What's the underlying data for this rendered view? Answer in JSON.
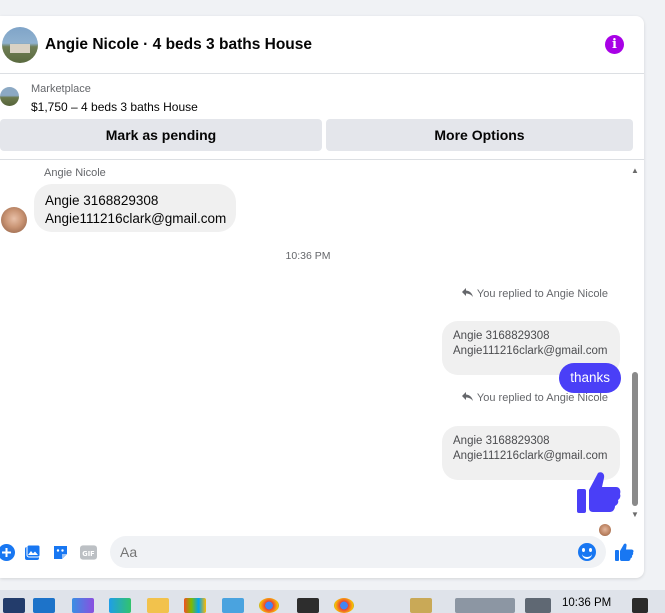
{
  "header": {
    "title": "Angie Nicole · 4 beds 3 baths House"
  },
  "listing": {
    "label": "Marketplace",
    "price": "$1,750 – 4 beds 3 baths House"
  },
  "actions": {
    "pending_label": "Mark as pending",
    "options_label": "More Options"
  },
  "conversation": {
    "sender_name": "Angie Nicole",
    "incoming": {
      "line1": "Angie 3168829308",
      "line2": "Angie111216clark@gmail.com"
    },
    "timestamp": "10:36 PM",
    "replies": [
      {
        "label": "You replied to Angie Nicole",
        "quote1": "Angie 3168829308",
        "quote2": "Angie111216clark@gmail.com",
        "message": "thanks"
      },
      {
        "label": "You replied to Angie Nicole",
        "quote1": "Angie 3168829308",
        "quote2": "Angie111216clark@gmail.com",
        "message_icon": "thumbs-up-icon"
      }
    ]
  },
  "composer": {
    "placeholder": "Aa"
  },
  "taskbar": {
    "clock": "10:36 PM"
  },
  "colors": {
    "accent": "#1877f2",
    "bubble_out": "#4a3ff7",
    "info": "#a800e6"
  }
}
